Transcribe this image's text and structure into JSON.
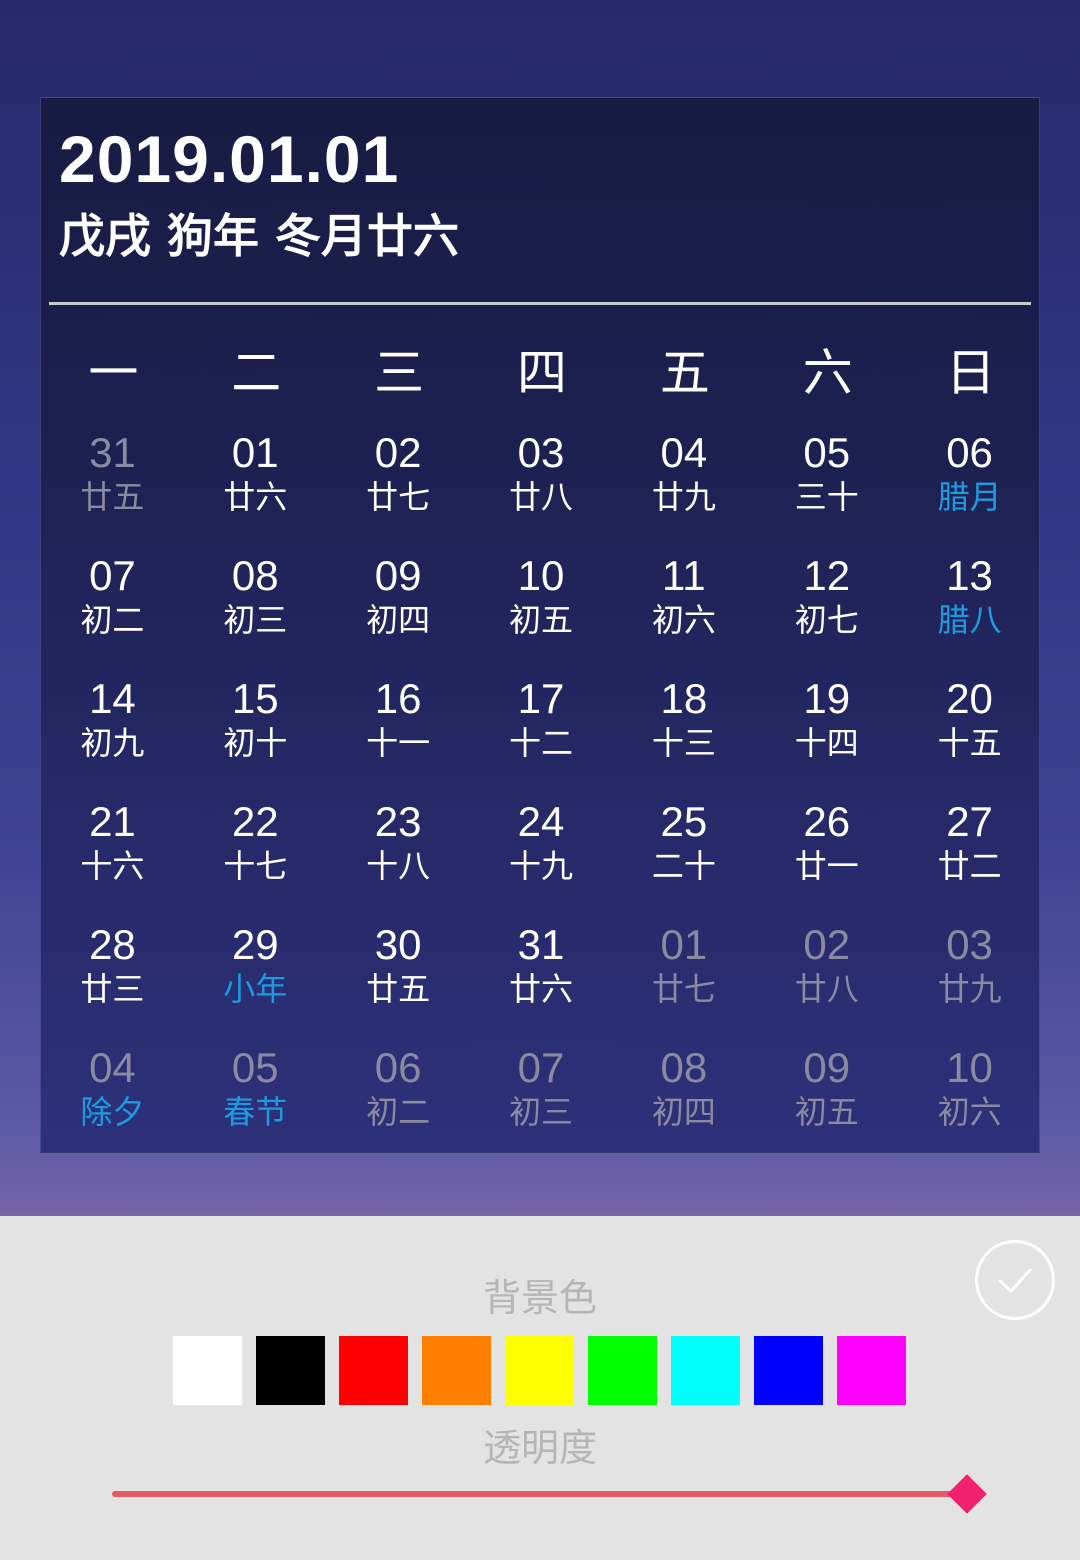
{
  "calendar": {
    "date_text": "2019.01.01",
    "lunar_text": "戊戌 狗年 冬月廿六",
    "weekdays": [
      "一",
      "二",
      "三",
      "四",
      "五",
      "六",
      "日"
    ],
    "days": [
      {
        "d": "31",
        "l": "廿五",
        "other": true
      },
      {
        "d": "01",
        "l": "廿六"
      },
      {
        "d": "02",
        "l": "廿七"
      },
      {
        "d": "03",
        "l": "廿八"
      },
      {
        "d": "04",
        "l": "廿九"
      },
      {
        "d": "05",
        "l": "三十"
      },
      {
        "d": "06",
        "l": "腊月",
        "festival": true
      },
      {
        "d": "07",
        "l": "初二"
      },
      {
        "d": "08",
        "l": "初三"
      },
      {
        "d": "09",
        "l": "初四"
      },
      {
        "d": "10",
        "l": "初五"
      },
      {
        "d": "11",
        "l": "初六"
      },
      {
        "d": "12",
        "l": "初七"
      },
      {
        "d": "13",
        "l": "腊八",
        "festival": true
      },
      {
        "d": "14",
        "l": "初九"
      },
      {
        "d": "15",
        "l": "初十"
      },
      {
        "d": "16",
        "l": "十一"
      },
      {
        "d": "17",
        "l": "十二"
      },
      {
        "d": "18",
        "l": "十三"
      },
      {
        "d": "19",
        "l": "十四"
      },
      {
        "d": "20",
        "l": "十五"
      },
      {
        "d": "21",
        "l": "十六"
      },
      {
        "d": "22",
        "l": "十七"
      },
      {
        "d": "23",
        "l": "十八"
      },
      {
        "d": "24",
        "l": "十九"
      },
      {
        "d": "25",
        "l": "二十"
      },
      {
        "d": "26",
        "l": "廿一"
      },
      {
        "d": "27",
        "l": "廿二"
      },
      {
        "d": "28",
        "l": "廿三"
      },
      {
        "d": "29",
        "l": "小年",
        "festival": true
      },
      {
        "d": "30",
        "l": "廿五"
      },
      {
        "d": "31",
        "l": "廿六"
      },
      {
        "d": "01",
        "l": "廿七",
        "other": true
      },
      {
        "d": "02",
        "l": "廿八",
        "other": true
      },
      {
        "d": "03",
        "l": "廿九",
        "other": true
      },
      {
        "d": "04",
        "l": "除夕",
        "other": true,
        "festival": true
      },
      {
        "d": "05",
        "l": "春节",
        "other": true,
        "festival": true
      },
      {
        "d": "06",
        "l": "初二",
        "other": true
      },
      {
        "d": "07",
        "l": "初三",
        "other": true
      },
      {
        "d": "08",
        "l": "初四",
        "other": true
      },
      {
        "d": "09",
        "l": "初五",
        "other": true
      },
      {
        "d": "10",
        "l": "初六",
        "other": true
      }
    ]
  },
  "settings": {
    "bg_color_label": "背景色",
    "opacity_label": "透明度",
    "colors": [
      "#ffffff",
      "#000000",
      "#ff0000",
      "#ff8000",
      "#ffff00",
      "#00ff00",
      "#00ffff",
      "#0000ff",
      "#ff00ff"
    ],
    "opacity_value": 1.0,
    "confirm_icon": "check-icon",
    "accent_color": "#f0226d",
    "festival_color": "#1e9be0"
  }
}
